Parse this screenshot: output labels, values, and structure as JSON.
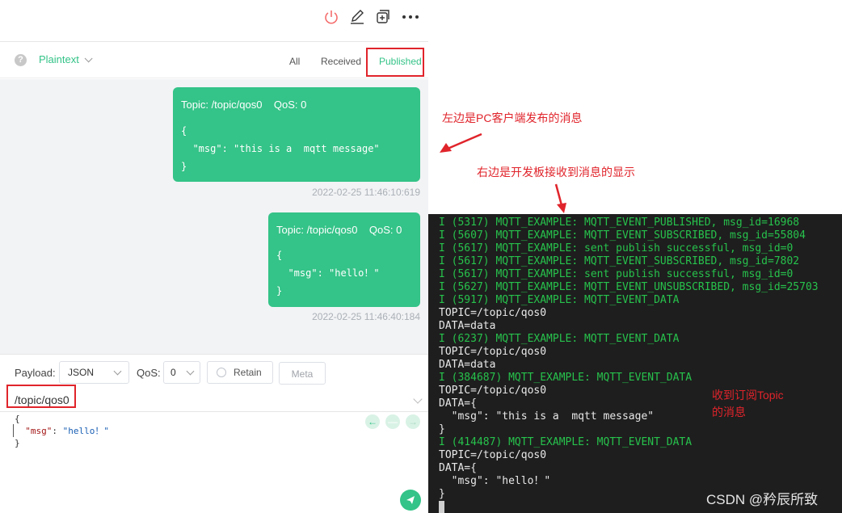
{
  "toolbar": {
    "icons": [
      "power-icon",
      "edit-icon",
      "new-window-icon",
      "more-icon"
    ],
    "accent_danger": "#f56c6c"
  },
  "filter_bar": {
    "format": "Plaintext",
    "tabs": [
      "All",
      "Received",
      "Published"
    ],
    "active_tab": "Published"
  },
  "messages": [
    {
      "header": "Topic: /topic/qos0    QoS: 0",
      "payload": "{\n  \"msg\": \"this is a  mqtt message\"\n}",
      "timestamp": "2022-02-25 11:46:10:619"
    },
    {
      "header": "Topic: /topic/qos0    QoS: 0",
      "payload": "{\n  \"msg\": \"hello！\"\n}",
      "timestamp": "2022-02-25 11:46:40:184"
    }
  ],
  "compose": {
    "payload_label": "Payload:",
    "payload_format": "JSON",
    "qos_label": "QoS:",
    "qos_value": "0",
    "retain_label": "Retain",
    "meta_label": "Meta",
    "topic": "/topic/qos0",
    "editor": {
      "line1": "{",
      "key": "\"msg\"",
      "colon": ": ",
      "value": "\"hello！\"",
      "line3": "}"
    }
  },
  "annotations": {
    "left": "左边是PC客户端发布的消息",
    "right": "右边是开发板接收到消息的显示",
    "topic_line1": "收到订阅Topic",
    "topic_line2": "的消息"
  },
  "terminal": {
    "lines": [
      {
        "text": "I (5317) MQTT_EXAMPLE: MQTT_EVENT_PUBLISHED, msg_id=16968",
        "color": "green"
      },
      {
        "text": "I (5607) MQTT_EXAMPLE: MQTT_EVENT_SUBSCRIBED, msg_id=55804",
        "color": "green"
      },
      {
        "text": "I (5617) MQTT_EXAMPLE: sent publish successful, msg_id=0",
        "color": "green"
      },
      {
        "text": "I (5617) MQTT_EXAMPLE: MQTT_EVENT_SUBSCRIBED, msg_id=7802",
        "color": "green"
      },
      {
        "text": "I (5617) MQTT_EXAMPLE: sent publish successful, msg_id=0",
        "color": "green"
      },
      {
        "text": "I (5627) MQTT_EXAMPLE: MQTT_EVENT_UNSUBSCRIBED, msg_id=25703",
        "color": "green"
      },
      {
        "text": "I (5917) MQTT_EXAMPLE: MQTT_EVENT_DATA",
        "color": "green"
      },
      {
        "text": "TOPIC=/topic/qos0",
        "color": "white"
      },
      {
        "text": "DATA=data",
        "color": "white"
      },
      {
        "text": "I (6237) MQTT_EXAMPLE: MQTT_EVENT_DATA",
        "color": "green"
      },
      {
        "text": "TOPIC=/topic/qos0",
        "color": "white"
      },
      {
        "text": "DATA=data",
        "color": "white"
      },
      {
        "text": "I (384687) MQTT_EXAMPLE: MQTT_EVENT_DATA",
        "color": "green"
      },
      {
        "text": "TOPIC=/topic/qos0",
        "color": "white"
      },
      {
        "text": "DATA={",
        "color": "white"
      },
      {
        "text": "  \"msg\": \"this is a  mqtt message\"",
        "color": "white"
      },
      {
        "text": "}",
        "color": "white"
      },
      {
        "text": "I (414487) MQTT_EXAMPLE: MQTT_EVENT_DATA",
        "color": "green"
      },
      {
        "text": "TOPIC=/topic/qos0",
        "color": "white"
      },
      {
        "text": "DATA={",
        "color": "white"
      },
      {
        "text": "  \"msg\": \"hello！\"",
        "color": "white"
      },
      {
        "text": "}",
        "color": "white"
      }
    ]
  },
  "watermark": "CSDN @矜辰所致",
  "colors": {
    "accent": "#34c388",
    "annotation": "#e0242b",
    "terminal_bg": "#1e1e1e",
    "terminal_green": "#27c24c"
  }
}
